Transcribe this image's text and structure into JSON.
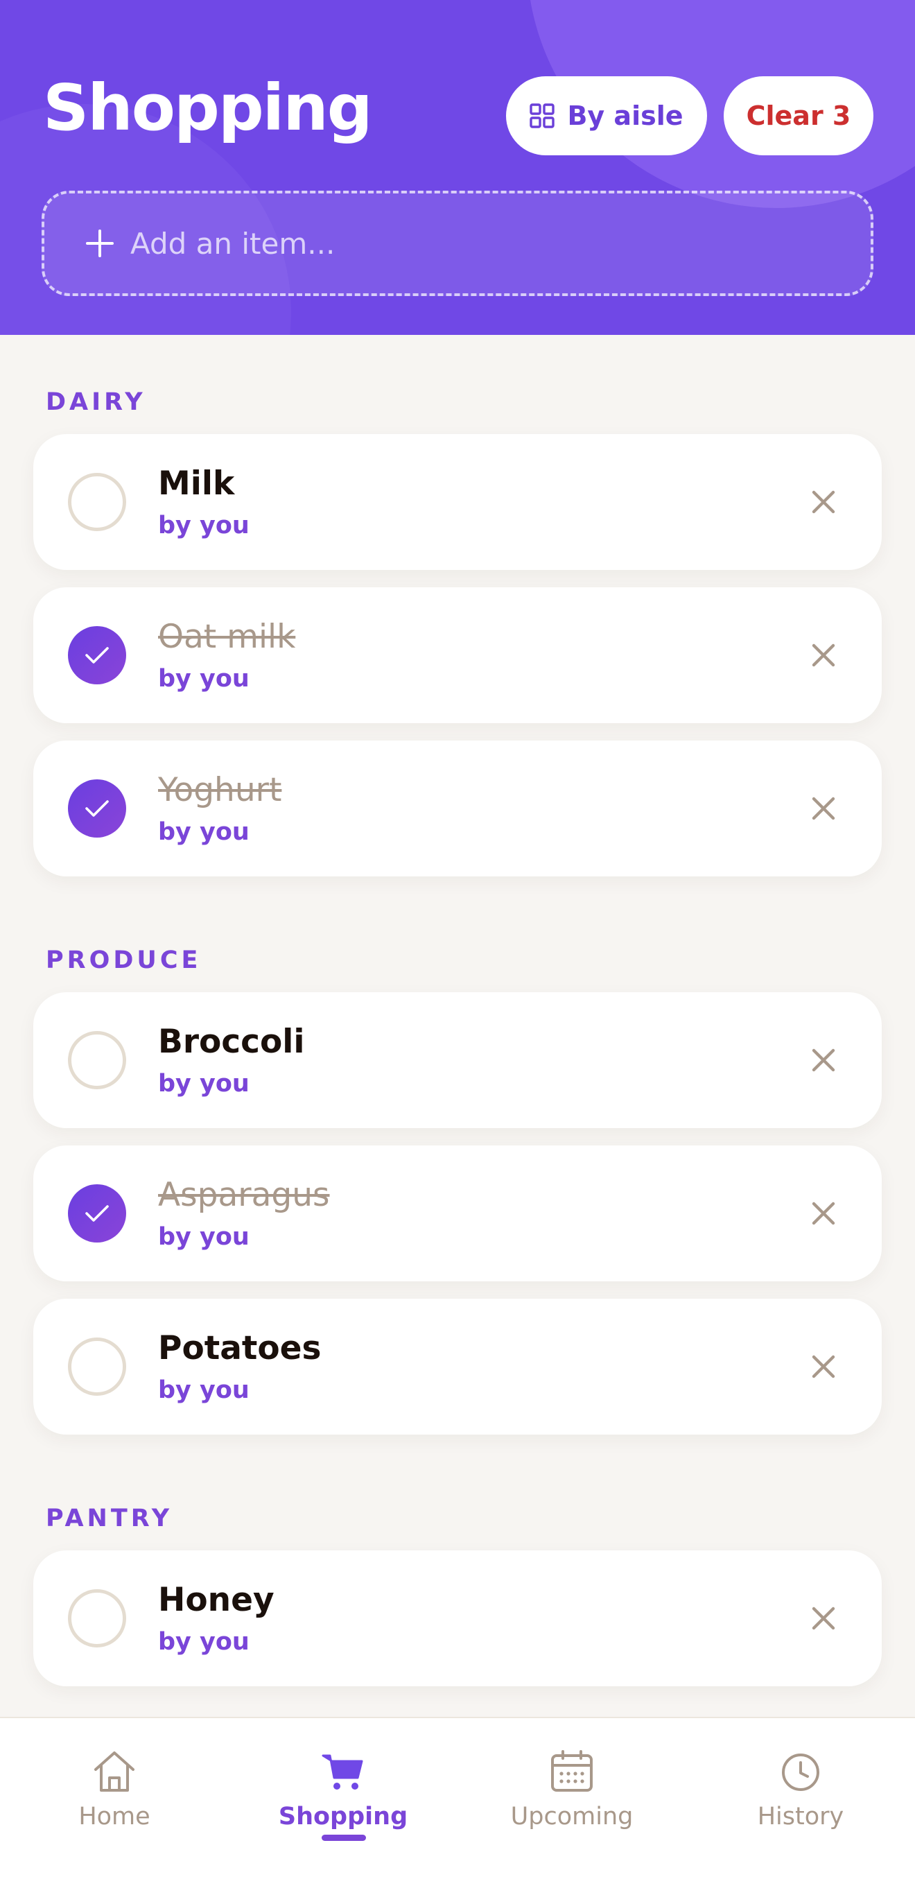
{
  "header": {
    "title": "Shopping",
    "by_aisle_label": "By aisle",
    "clear_label": "Clear 3",
    "add_placeholder": "Add an item..."
  },
  "sections": [
    {
      "label": "DAIRY",
      "items": [
        {
          "name": "Milk",
          "by": "by you",
          "checked": false
        },
        {
          "name": "Oat milk",
          "by": "by you",
          "checked": true
        },
        {
          "name": "Yoghurt",
          "by": "by you",
          "checked": true
        }
      ]
    },
    {
      "label": "PRODUCE",
      "items": [
        {
          "name": "Broccoli",
          "by": "by you",
          "checked": false
        },
        {
          "name": "Asparagus",
          "by": "by you",
          "checked": true
        },
        {
          "name": "Potatoes",
          "by": "by you",
          "checked": false
        }
      ]
    },
    {
      "label": "PANTRY",
      "items": [
        {
          "name": "Honey",
          "by": "by you",
          "checked": false
        }
      ]
    }
  ],
  "nav": {
    "items": [
      {
        "label": "Home",
        "icon": "home-icon",
        "active": false
      },
      {
        "label": "Shopping",
        "icon": "cart-icon",
        "active": true
      },
      {
        "label": "Upcoming",
        "icon": "calendar-icon",
        "active": false
      },
      {
        "label": "History",
        "icon": "clock-icon",
        "active": false
      }
    ]
  },
  "colors": {
    "accent": "#7048e6",
    "accent_text": "#7a45d8",
    "danger": "#cc2f2f",
    "muted": "#a8988a"
  }
}
